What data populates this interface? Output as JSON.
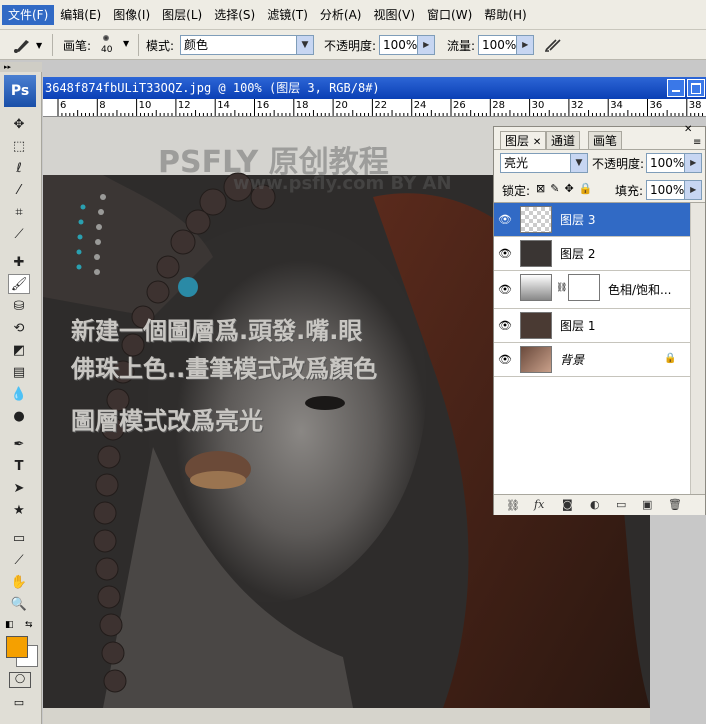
{
  "menubar": {
    "items": [
      "文件(F)",
      "编辑(E)",
      "图像(I)",
      "图层(L)",
      "选择(S)",
      "滤镜(T)",
      "分析(A)",
      "视图(V)",
      "窗口(W)",
      "帮助(H)"
    ]
  },
  "options": {
    "brush_label": "画笔:",
    "brush_size": "40",
    "mode_label": "模式:",
    "mode_value": "颜色",
    "opacity_label": "不透明度:",
    "opacity_value": "100%",
    "flow_label": "流量:",
    "flow_value": "100%"
  },
  "document": {
    "title": "3648f874fbULiT33OQZ.jpg @ 100% (图层 3, RGB/8#)",
    "ruler_numbers": [
      "6",
      "8",
      "10",
      "12",
      "14",
      "16",
      "18",
      "20",
      "22",
      "24",
      "26",
      "28",
      "30",
      "32",
      "34",
      "36",
      "38"
    ]
  },
  "canvas_text": {
    "line1": "新建一個圖層爲.頭發.嘴.眼",
    "line2": "佛珠上色..畫筆模式改爲顏色",
    "line3": "圖層模式改爲亮光",
    "watermark1": "PSFLY 原创教程",
    "watermark2": "www.psfly.com BY AN"
  },
  "panel": {
    "tabs": [
      "图层",
      "通道",
      "画笔"
    ],
    "blend_mode": "亮光",
    "opacity_label": "不透明度:",
    "opacity_value": "100%",
    "lock_label": "锁定:",
    "fill_label": "填充:",
    "fill_value": "100%",
    "layers": [
      {
        "name": "图层 3",
        "selected": true
      },
      {
        "name": "图层 2",
        "selected": false
      },
      {
        "name": "色相/饱和...",
        "selected": false
      },
      {
        "name": "图层 1",
        "selected": false
      },
      {
        "name": "背景",
        "selected": false
      }
    ]
  },
  "colors": {
    "foreground": "#f5a000",
    "background": "#ffffff",
    "selection": "#316ac5"
  },
  "ps_logo": "Ps"
}
